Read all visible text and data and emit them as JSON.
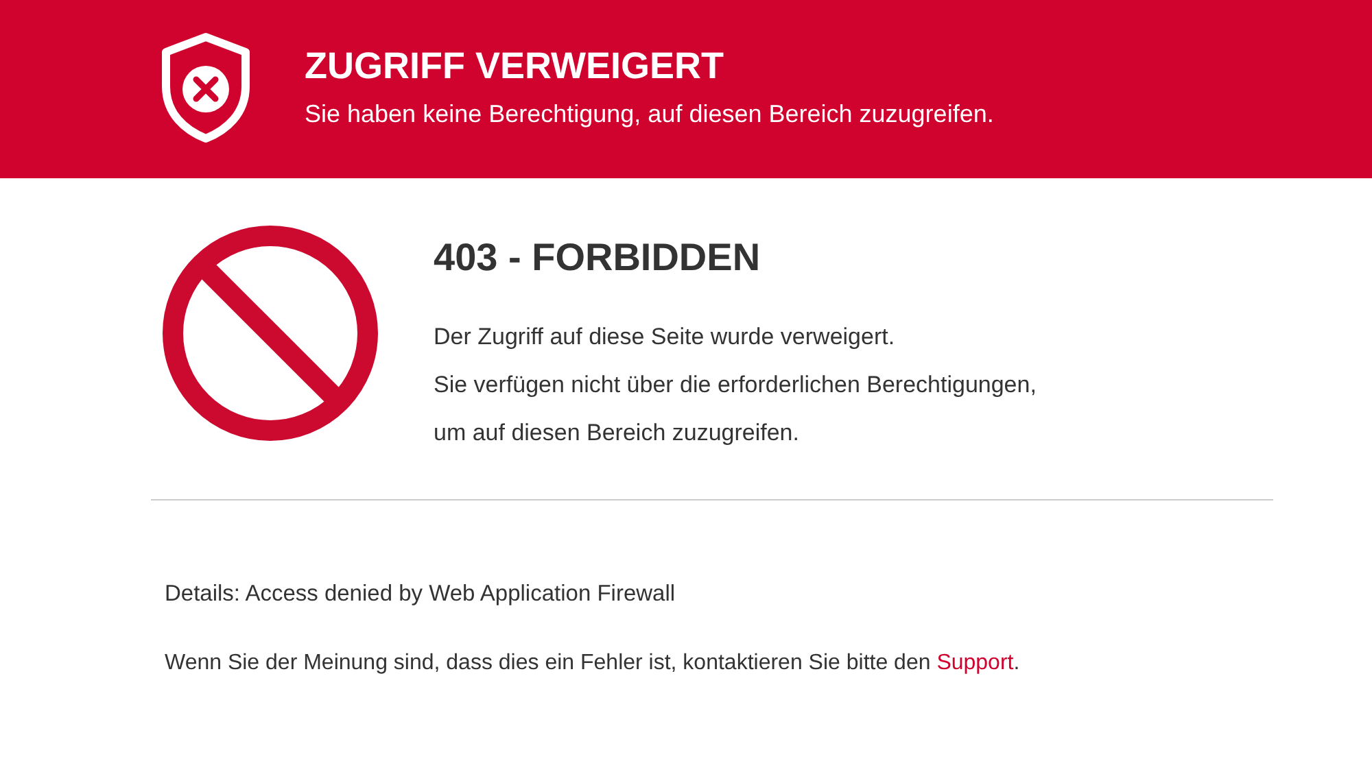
{
  "banner": {
    "title": "ZUGRIFF VERWEIGERT",
    "subtitle": "Sie haben keine Berechtigung, auf diesen Bereich zuzugreifen."
  },
  "error": {
    "heading": "403 - FORBIDDEN",
    "lines": [
      "Der Zugriff auf diese Seite wurde verweigert.",
      "Sie verfügen nicht über die erforderlichen Berechtigungen,",
      "um auf diesen Bereich zuzugreifen."
    ]
  },
  "details": "Details: Access denied by Web Application Firewall",
  "contact": {
    "text": "Wenn Sie der Meinung sind, dass dies ein Fehler ist, kontaktieren Sie bitte den ",
    "link": "Support",
    "after": "."
  }
}
